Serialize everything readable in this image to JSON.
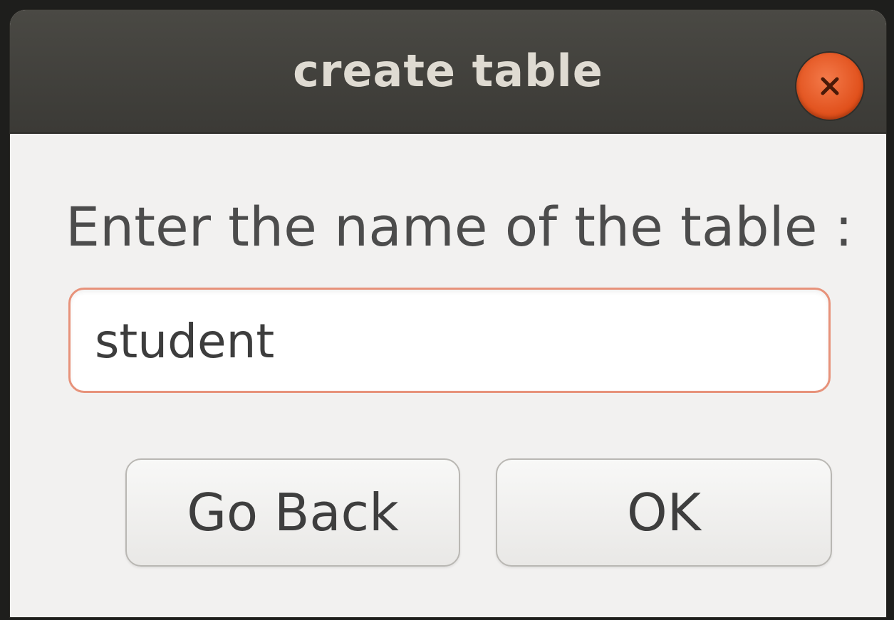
{
  "window": {
    "title": "create table",
    "close_icon": "close-icon"
  },
  "form": {
    "prompt": "Enter the name of the table :",
    "table_name_value": "student"
  },
  "buttons": {
    "back_label": "Go Back",
    "ok_label": "OK"
  },
  "colors": {
    "titlebar": "#3f3e3a",
    "close_button": "#e2541f",
    "input_focus_border": "#e7927a",
    "dialog_background": "#f2f1f0"
  }
}
